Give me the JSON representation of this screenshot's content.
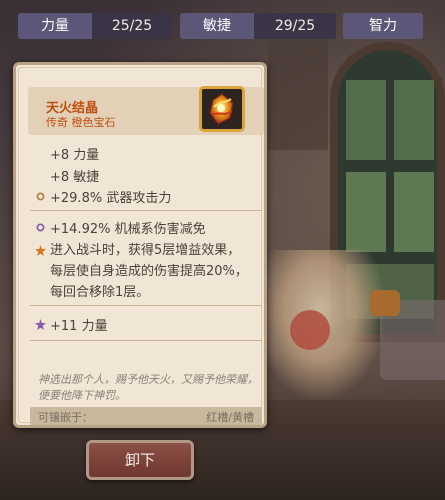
{
  "stats": [
    {
      "label": "力量",
      "value": "25/25"
    },
    {
      "label": "敏捷",
      "value": "29/25"
    },
    {
      "label": "智力",
      "value": ""
    }
  ],
  "item": {
    "name": "天火结晶",
    "subtitle": "传奇 橙色宝石",
    "icon": "fire-crystal-gem-icon",
    "rarity_color": "#c04e10"
  },
  "base_stats": [
    "+8 力量",
    "+8 敏捷",
    "+29.8% 武器攻击力"
  ],
  "affixes": {
    "damage_reduction": "+14.92% 机械系伤害减免",
    "special_effect": "进入战斗时，获得5层增益效果，每层使自身造成的伤害提高20%，每回合移除1层。",
    "bonus_strength": "+11 力量"
  },
  "flavor_text": "神选出那个人，赐予他天火，又赐予他荣耀，便要他降下神罚。",
  "sockets": {
    "label": "可镶嵌于：",
    "value": "红槽/黄槽"
  },
  "actions": {
    "unequip_label": "卸下"
  }
}
